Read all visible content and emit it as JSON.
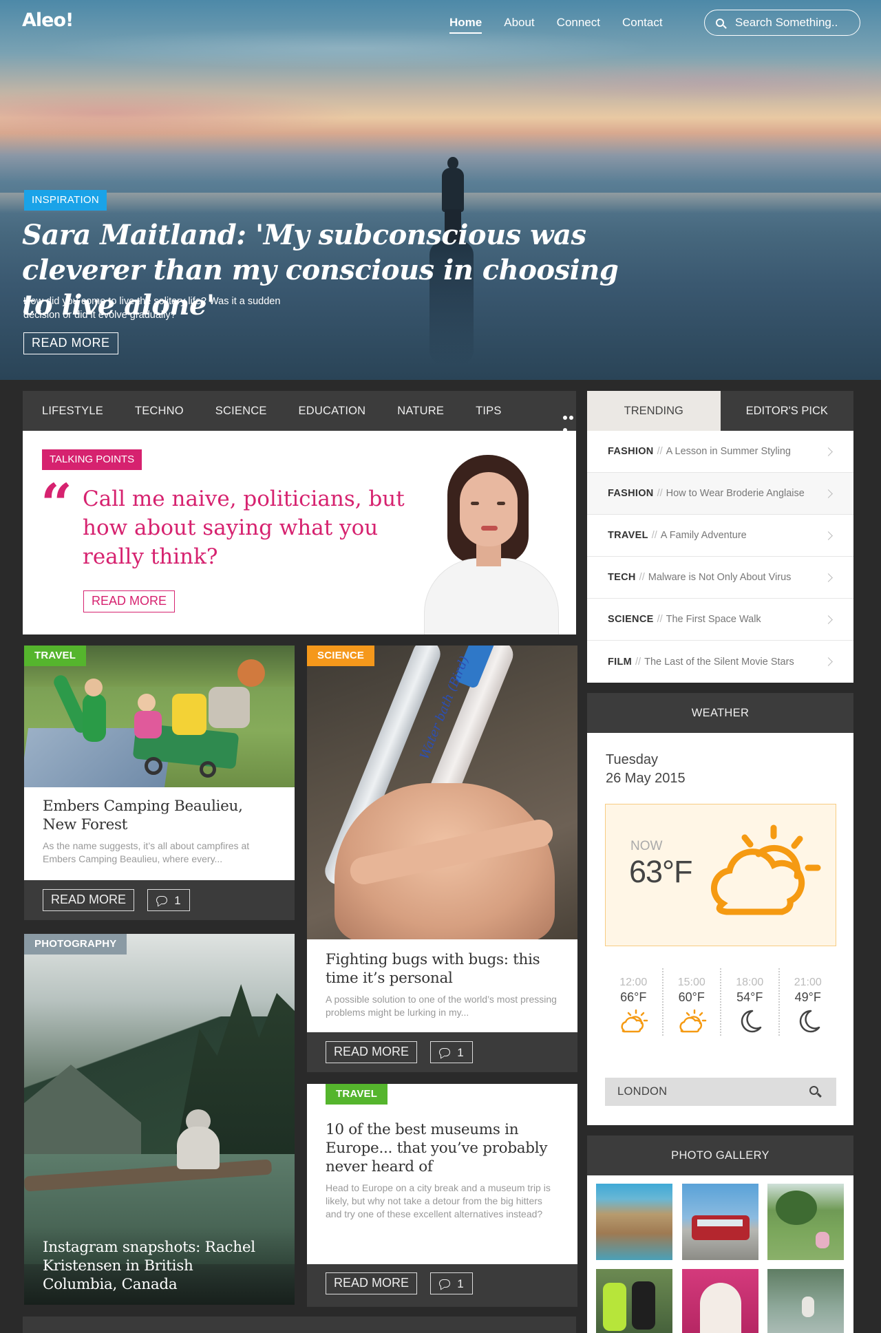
{
  "nav": {
    "logo": "Aleo!",
    "links": [
      "Home",
      "About",
      "Connect",
      "Contact"
    ],
    "search_placeholder": "Search Something.."
  },
  "hero": {
    "badge": "INSPIRATION",
    "title": "Sara Maitland: 'My subconscious was cleverer than my conscious in choosing to live alone'",
    "subtitle": "How did you come to live the solitary life? Was it a sudden decision or did it evolve gradually?",
    "button": "READ MORE",
    "badge_color": "#1aa3e8"
  },
  "categories": [
    "LIFESTYLE",
    "TECHNO",
    "SCIENCE",
    "EDUCATION",
    "NATURE",
    "TIPS"
  ],
  "talking": {
    "badge": "TALKING POINTS",
    "quote": "Call me naive, politicians, but how about saying what you really think?",
    "button": "READ MORE",
    "accent": "#d6226f"
  },
  "cards": {
    "camping": {
      "tag": "TRAVEL",
      "title": "Embers Camping Beaulieu, New Forest",
      "excerpt": "As the name suggests, it’s all about campfires at Embers Camping Beaulieu, where every...",
      "button": "READ MORE",
      "comments": "1"
    },
    "bugs": {
      "tag": "SCIENCE",
      "title": "Fighting bugs with bugs: this time it’s personal",
      "excerpt": "A possible solution to one of the world’s most pressing problems might be lurking in my...",
      "button": "READ MORE",
      "comments": "1",
      "pen_text": "Water bath (Bird)"
    },
    "photo": {
      "tag": "PHOTOGRAPHY",
      "title": "Instagram snapshots: Rachel Kristensen in British Columbia, Canada"
    },
    "museums": {
      "tag": "TRAVEL",
      "title": "10 of the best museums in Europe... that you’ve probably never heard of",
      "excerpt": "Head to Europe on a city break and a museum trip is likely, but why not take a detour from the big hitters and try one of these excellent alternatives instead?",
      "button": "READ MORE",
      "comments": "1"
    }
  },
  "sidebar": {
    "tabs": [
      "TRENDING",
      "EDITOR'S PICK"
    ],
    "trending": [
      {
        "cat": "FASHION",
        "title": "A Lesson in Summer Styling"
      },
      {
        "cat": "FASHION",
        "title": "How to Wear Broderie Anglaise"
      },
      {
        "cat": "TRAVEL",
        "title": "A Family Adventure"
      },
      {
        "cat": "TECH",
        "title": "Malware is Not Only About Virus"
      },
      {
        "cat": "SCIENCE",
        "title": "The First Space Walk"
      },
      {
        "cat": "FILM",
        "title": "The Last of the Silent Movie Stars"
      }
    ],
    "separator": "//"
  },
  "weather": {
    "heading": "WEATHER",
    "day": "Tuesday",
    "date": "26 May 2015",
    "now_label": "NOW",
    "now_temp": "63°F",
    "now_icon": "partly-sunny-icon",
    "hours": [
      {
        "time": "12:00",
        "temp": "66°F",
        "icon": "partly-sunny-icon"
      },
      {
        "time": "15:00",
        "temp": "60°F",
        "icon": "partly-sunny-icon"
      },
      {
        "time": "18:00",
        "temp": "54°F",
        "icon": "moon-icon"
      },
      {
        "time": "21:00",
        "temp": "49°F",
        "icon": "moon-icon"
      }
    ],
    "location": "LONDON",
    "accent": "#f59a12"
  },
  "gallery": {
    "heading": "PHOTO GALLERY"
  }
}
